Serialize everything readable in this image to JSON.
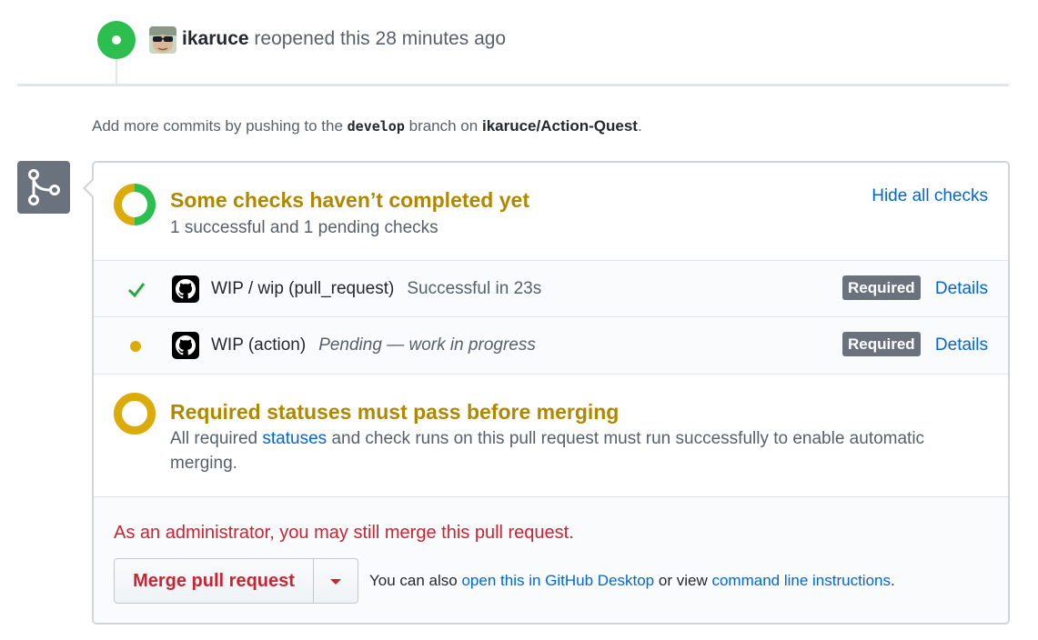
{
  "event": {
    "author": "ikaruce",
    "action": "reopened this",
    "time": "28 minutes ago"
  },
  "push_hint": {
    "prefix": "Add more commits by pushing to the",
    "branch": "develop",
    "middle": "branch on",
    "repo": "ikaruce/Action-Quest",
    "suffix": "."
  },
  "checks_status": {
    "title": "Some checks haven’t completed yet",
    "subtitle": "1 successful and 1 pending checks",
    "hide_link": "Hide all checks"
  },
  "checks": [
    {
      "name": "WIP / wip (pull_request)",
      "description": "Successful in 23s",
      "state": "success",
      "badge": "Required",
      "details": "Details"
    },
    {
      "name": "WIP (action)",
      "description": "Pending — work in progress",
      "state": "pending",
      "badge": "Required",
      "details": "Details"
    }
  ],
  "required_status": {
    "title": "Required statuses must pass before merging",
    "desc_prefix": "All required",
    "desc_link": "statuses",
    "desc_suffix": "and check runs on this pull request must run successfully to enable automatic merging."
  },
  "merge": {
    "admin_message": "As an administrator, you may still merge this pull request.",
    "button_label": "Merge pull request",
    "alt_prefix": "You can also",
    "alt_link1": "open this in GitHub Desktop",
    "alt_middle": "or view",
    "alt_link2": "command line instructions",
    "alt_suffix": "."
  },
  "colors": {
    "success": "#2cbe4e",
    "pending": "#dbab09",
    "warning_text": "#b08800",
    "danger": "#cb2431",
    "link": "#0366d6"
  },
  "icons": {
    "event": "reopened-dot-icon",
    "merge": "git-merge-icon",
    "success": "check-icon",
    "pending": "dot-icon",
    "app": "github-mark-icon",
    "dropdown": "triangle-down-icon"
  }
}
